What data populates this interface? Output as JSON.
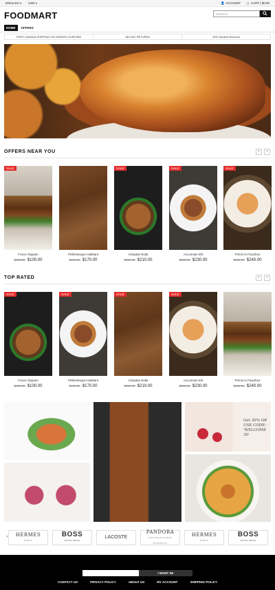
{
  "topbar": {
    "language": "ENGLISH",
    "currency": "USD",
    "account": "ACCOUNT",
    "cart": "CART | $0.00"
  },
  "header": {
    "logo": "FOODMART",
    "search_placeholder": "SEARCH"
  },
  "nav": {
    "items": [
      "HOME",
      "OFFERS"
    ]
  },
  "shipping_bar": [
    "FREE CANADA SHIPPING ON ORDERS OVER $50",
    "180 DAY RETURNS",
    "20% Student Discount"
  ],
  "sections": {
    "offers_title": "OFFERS NEAR YOU",
    "top_rated_title": "TOP RATED"
  },
  "offers": [
    {
      "name": "Fusce Aliquam",
      "old_price": "$200.00",
      "price": "$100.00",
      "badge": "SALE"
    },
    {
      "name": "Pellentesque Habitant",
      "old_price": "$190.00",
      "price": "$170.00",
      "badge": ""
    },
    {
      "name": "Voluptas Nulla",
      "old_price": "$320.00",
      "price": "$210.00",
      "badge": "SALE"
    },
    {
      "name": "Accumsan Elit",
      "old_price": "$280.00",
      "price": "$230.00",
      "badge": "SALE"
    },
    {
      "name": "Primis In Faucibus",
      "old_price": "$320.00",
      "price": "$240.00",
      "badge": "SALE"
    }
  ],
  "top_rated": [
    {
      "name": "Fusce Aliquam",
      "old_price": "$200.00",
      "price": "$100.00",
      "badge": "SALE"
    },
    {
      "name": "Pellentesque Habitant",
      "old_price": "$190.00",
      "price": "$170.00",
      "badge": "SALE"
    },
    {
      "name": "Voluptas Nulla",
      "old_price": "$320.00",
      "price": "$210.00",
      "badge": "SALE"
    },
    {
      "name": "Accumsan Elit",
      "old_price": "$280.00",
      "price": "$230.00",
      "badge": "SALE"
    },
    {
      "name": "Primis In Faucibus",
      "old_price": "$320.00",
      "price": "$240.00",
      "badge": ""
    }
  ],
  "promo": {
    "line1": "Get 30% Off",
    "line2": "USE CODE:",
    "line3": "'WELCOME 30'"
  },
  "brands": [
    {
      "name": "HERMES",
      "sub": "PARIS"
    },
    {
      "name": "BOSS",
      "sub": "HUGO BOSS"
    },
    {
      "name": "LACOSTE",
      "sub": ""
    },
    {
      "name": "PANDORA",
      "sub": "UNFORGETTABLE MOMENTS"
    },
    {
      "name": "HERMES",
      "sub": "PARIS"
    },
    {
      "name": "BOSS",
      "sub": "HUGO BOSS"
    }
  ],
  "footer": {
    "newsletter_button": "I WANT IN!",
    "links": [
      "CONTACT US",
      "PRIVACY POLICY",
      "ABOUT US",
      "MY ACCOUNT",
      "SHIPPING POLICY"
    ]
  },
  "colors": {
    "sale_badge": "#e52b2b",
    "footer_bg": "#000000",
    "active_nav": "#111111"
  }
}
